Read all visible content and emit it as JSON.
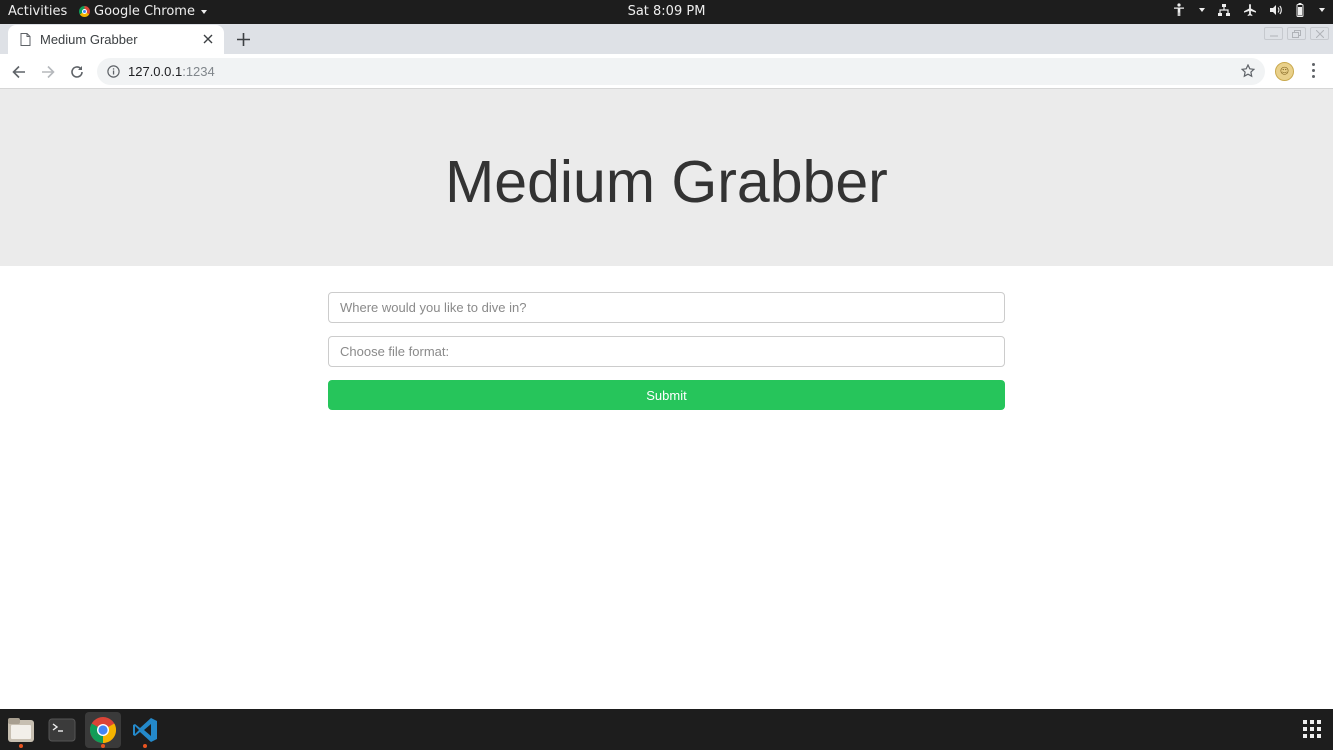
{
  "system_bar": {
    "activities": "Activities",
    "app_name": "Google Chrome",
    "clock": "Sat  8:09 PM"
  },
  "browser": {
    "tab_title": "Medium Grabber",
    "url_host": "127.0.0.1",
    "url_port": ":1234"
  },
  "page": {
    "title": "Medium Grabber",
    "topic_placeholder": "Where would you like to dive in?",
    "format_placeholder": "Choose file format:",
    "submit_label": "Submit"
  },
  "colors": {
    "hero_bg": "#ebebeb",
    "submit_green": "#26c55b",
    "system_bar": "#1d1d1d"
  },
  "dock": {
    "items": [
      "files-icon",
      "terminal-icon",
      "chrome-icon",
      "vscode-icon"
    ],
    "show_apps": "grid-icon"
  }
}
